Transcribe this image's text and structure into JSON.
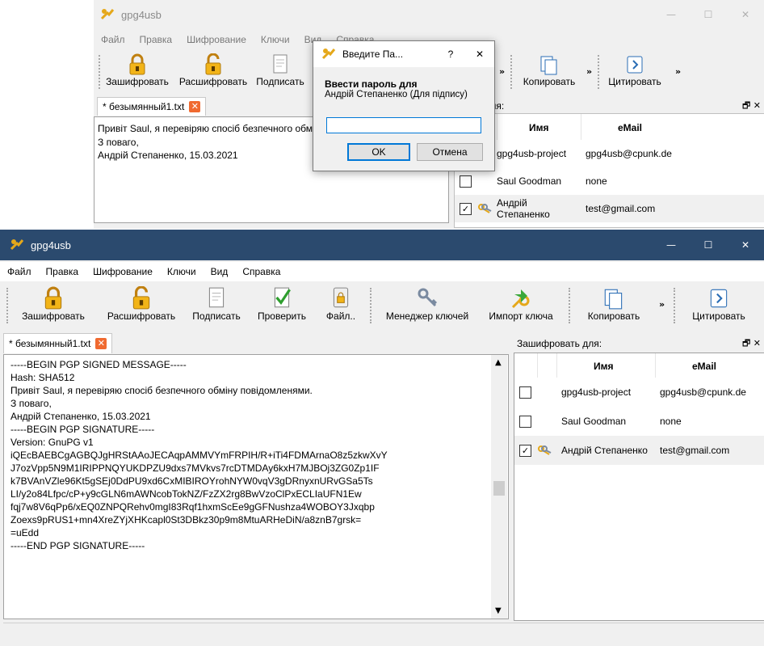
{
  "colors": {
    "bg_title_dark": "#2b4a6e",
    "accent": "#0078d7",
    "lock": "#e5a81a",
    "tab_close": "#f06a30"
  },
  "back_window": {
    "title": "gpg4usb",
    "menu": [
      "Файл",
      "Правка",
      "Шифрование",
      "Ключи",
      "Вид",
      "Справка"
    ],
    "toolbar": {
      "encrypt": "Зашифровать",
      "decrypt": "Расшифровать",
      "sign": "Подписать",
      "copy": "Копировать",
      "quote": "Цитировать",
      "overflow": "»"
    },
    "tab_label": "* безымянный1.txt",
    "editor_lines": [
      "Привіт Saul, я перевіряю спосіб безпечного обмі",
      "",
      "З поваго,",
      "",
      "Андрій Степаненко, 15.03.2021"
    ],
    "dock_title": "овать для:",
    "recipients_header": {
      "name": "Имя",
      "email": "eMail"
    },
    "recipients": [
      {
        "checked": false,
        "name": "gpg4usb-project",
        "email": "gpg4usb@cpunk.de",
        "has_key_icon": false
      },
      {
        "checked": false,
        "name": "Saul Goodman",
        "email": "none",
        "has_key_icon": false
      },
      {
        "checked": true,
        "name": "Андрій Степаненко",
        "email": "test@gmail.com",
        "has_key_icon": true
      }
    ]
  },
  "dialog": {
    "title": "Введите Па...",
    "help": "?",
    "close": "✕",
    "prompt_bold": "Ввести пароль для",
    "prompt_sub": "Андрій Степаненко (Для підпису)",
    "input_value": "",
    "ok": "OK",
    "cancel": "Отмена"
  },
  "main_window": {
    "title": "gpg4usb",
    "controls": {
      "minimize": "—",
      "maximize": "☐",
      "close": "✕"
    },
    "menu": [
      "Файл",
      "Правка",
      "Шифрование",
      "Ключи",
      "Вид",
      "Справка"
    ],
    "toolbar": {
      "encrypt": "Зашифровать",
      "decrypt": "Расшифровать",
      "sign": "Подписать",
      "verify": "Проверить",
      "file": "Файл..",
      "key_manager": "Менеджер ключей",
      "import_key": "Импорт ключа",
      "copy": "Копировать",
      "overflow": "»",
      "quote": "Цитировать"
    },
    "tab_label": "* безымянный1.txt",
    "editor_lines": [
      "-----BEGIN PGP SIGNED MESSAGE-----",
      "Hash: SHA512",
      "",
      "Привіт Saul, я перевіряю спосіб безпечного обміну повідомленями.",
      "",
      "З поваго,",
      "",
      "Андрій Степаненко, 15.03.2021",
      "-----BEGIN PGP SIGNATURE-----",
      "Version: GnuPG v1",
      "",
      "iQEcBAEBCgAGBQJgHRStAAoJECAqpAMMVYmFRPIH/R+iTi4FDMArnaO8z5zkwXvY",
      "J7ozVpp5N9M1IRIPPNQYUKDPZU9dxs7MVkvs7rcDTMDAy6kxH7MJBOj3ZG0Zp1IF",
      "k7BVAnVZle96Kt5gSEj0DdPU9xd6CxMIBIROYrohNYW0vqV3gDRnyxnURvGSa5Ts",
      "LI/y2o84Lfpc/cP+y9cGLN6mAWNcobTokNZ/FzZX2rg8BwVzoClPxECLIaUFN1Ew",
      "fqj7w8V6qPp6/xEQ0ZNPQRehv0mgI83Rqf1hxmScEe9gGFNushza4WOBOY3Jxqbp",
      "Zoexs9pRUS1+mn4XreZYjXHKcapl0St3DBkz30p9m8MtuARHeDiN/a8znB7grsk=",
      "=uEdd",
      "-----END PGP SIGNATURE-----"
    ],
    "dock_title": "Зашифровать для:",
    "dock_controls": "🗗 ✕",
    "recipients_header": {
      "name": "Имя",
      "email": "eMail"
    },
    "recipients": [
      {
        "checked": false,
        "name": "gpg4usb-project",
        "email": "gpg4usb@cpunk.de",
        "has_key_icon": false
      },
      {
        "checked": false,
        "name": "Saul Goodman",
        "email": "none",
        "has_key_icon": false
      },
      {
        "checked": true,
        "name": "Андрій Степаненко",
        "email": "test@gmail.com",
        "has_key_icon": true
      }
    ]
  }
}
